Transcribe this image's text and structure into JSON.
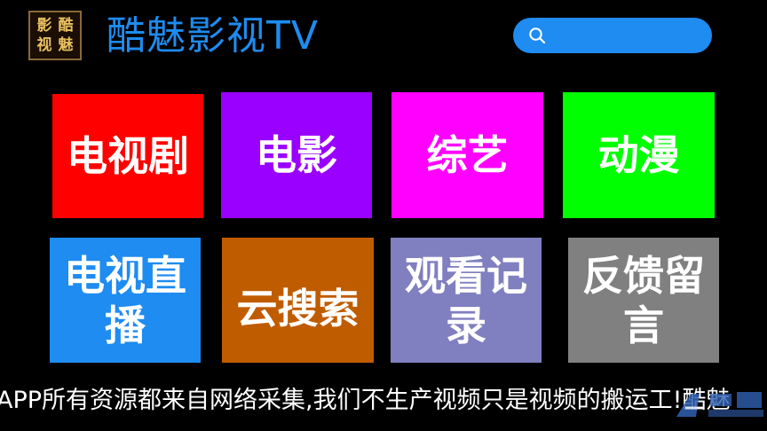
{
  "header": {
    "logo_chars": [
      "影",
      "酷",
      "视",
      "魅"
    ],
    "title": "酷魅影视TV",
    "search_icon": "search-icon"
  },
  "tiles": [
    {
      "label": "电视剧",
      "color": "#ff0000"
    },
    {
      "label": "电影",
      "color": "#9a00ff"
    },
    {
      "label": "综艺",
      "color": "#ff00ff"
    },
    {
      "label": "动漫",
      "color": "#00ff00"
    },
    {
      "label": "电视直播",
      "color": "#1e8cf0"
    },
    {
      "label": "云搜索",
      "color": "#c05c00"
    },
    {
      "label": "观看记录",
      "color": "#8080c0"
    },
    {
      "label": "反馈留言",
      "color": "#808080"
    }
  ],
  "ticker": {
    "text": "APP所有资源都来自网络采集,我们不生产视频只是视频的搬运工!酷魅"
  },
  "colors": {
    "background": "#000000",
    "accent": "#1e8cf0"
  }
}
